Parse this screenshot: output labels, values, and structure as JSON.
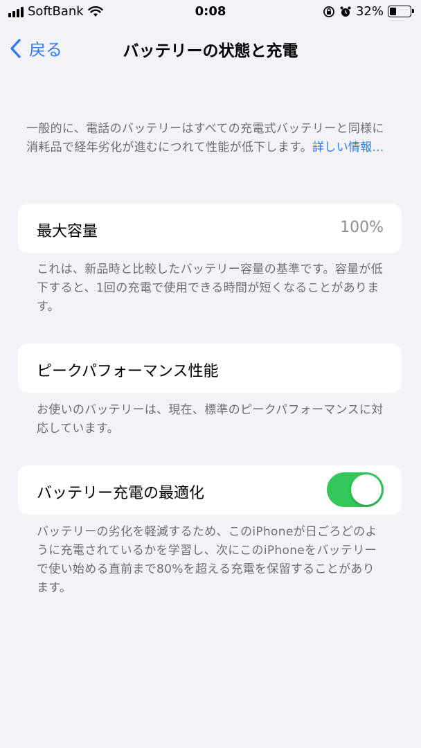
{
  "status_bar": {
    "carrier": "SoftBank",
    "time": "0:08",
    "battery_percent": "32%",
    "battery_level": 0.32,
    "icons": [
      "signal-icon",
      "wifi-icon",
      "orientation-lock-icon",
      "alarm-icon",
      "battery-icon"
    ]
  },
  "nav": {
    "back_label": "戻る",
    "title": "バッテリーの状態と充電"
  },
  "intro": {
    "text": "一般的に、電話のバッテリーはすべての充電式バッテリーと同様に消耗品で経年劣化が進むにつれて性能が低下します。",
    "link": "詳しい情報..."
  },
  "max_capacity": {
    "label": "最大容量",
    "value": "100%",
    "footnote": "これは、新品時と比較したバッテリー容量の基準です。容量が低下すると、1回の充電で使用できる時間が短くなることがあります。"
  },
  "peak_performance": {
    "label": "ピークパフォーマンス性能",
    "footnote": "お使いのバッテリーは、現在、標準のピークパフォーマンスに対応しています。"
  },
  "optimized_charging": {
    "label": "バッテリー充電の最適化",
    "enabled": true,
    "footnote": "バッテリーの劣化を軽減するため、このiPhoneが日ごろどのように充電されているかを学習し、次にこのiPhoneをバッテリーで使い始める直前まで80%を超える充電を保留することがあります。"
  },
  "colors": {
    "accent": "#2f7cf6",
    "toggle_on": "#34c759",
    "background": "#f2f2f7",
    "secondary_text": "#6d6d72"
  }
}
